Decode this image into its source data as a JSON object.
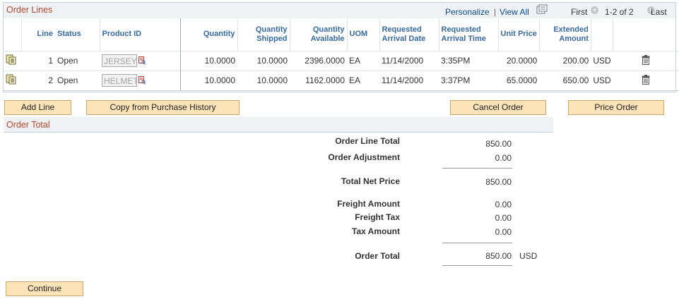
{
  "order_lines": {
    "title": "Order Lines",
    "nav": {
      "personalize": "Personalize",
      "separator": "|",
      "view_all": "View All",
      "first": "First",
      "range": "1-2 of 2",
      "last": "Last"
    },
    "headers": {
      "line": "Line",
      "status": "Status",
      "product_id": "Product ID",
      "quantity": "Quantity",
      "qty_shipped_1": "Quantity",
      "qty_shipped_2": "Shipped",
      "qty_available_1": "Quantity",
      "qty_available_2": "Available",
      "uom": "UOM",
      "req_date_1": "Requested",
      "req_date_2": "Arrival Date",
      "req_time_1": "Requested",
      "req_time_2": "Arrival Time",
      "unit_price": "Unit Price",
      "ext_amount_1": "Extended",
      "ext_amount_2": "Amount"
    },
    "rows": [
      {
        "line": "1",
        "status": "Open",
        "product_id": "JERSEY",
        "quantity": "10.0000",
        "shipped": "10.0000",
        "available": "2396.0000",
        "uom": "EA",
        "arrival_date": "11/14/2000",
        "arrival_time": "3:35PM",
        "unit_price": "20.0000",
        "extended_amount": "200.00",
        "currency": "USD"
      },
      {
        "line": "2",
        "status": "Open",
        "product_id": "HELMET",
        "quantity": "10.0000",
        "shipped": "10.0000",
        "available": "1162.0000",
        "uom": "EA",
        "arrival_date": "11/14/2000",
        "arrival_time": "3:37PM",
        "unit_price": "65.0000",
        "extended_amount": "650.00",
        "currency": "USD"
      }
    ]
  },
  "buttons": {
    "add_line": "Add Line",
    "copy_history": "Copy from Purchase History",
    "cancel_order": "Cancel Order",
    "price_order": "Price Order",
    "continue": "Continue"
  },
  "order_total": {
    "title": "Order Total",
    "order_line_total_label": "Order Line Total",
    "order_line_total": "850.00",
    "order_adjustment_label": "Order Adjustment",
    "order_adjustment": "0.00",
    "total_net_price_label": "Total Net Price",
    "total_net_price": "850.00",
    "freight_amount_label": "Freight Amount",
    "freight_amount": "0.00",
    "freight_tax_label": "Freight Tax",
    "freight_tax": "0.00",
    "tax_amount_label": "Tax Amount",
    "tax_amount": "0.00",
    "order_total_label": "Order Total",
    "order_total": "850.00",
    "currency": "USD"
  },
  "colors": {
    "section_title": "#b7472a",
    "header_text": "#356aa3",
    "link": "#0b4c8c",
    "button_bg": "#fce3b8",
    "button_border": "#c9a66b",
    "bar_bg": "#eef2f5"
  },
  "icons": {
    "row_detail": "row-detail-icon",
    "lookup": "lookup-icon",
    "delete": "trash-icon",
    "download": "download-grid-icon"
  }
}
